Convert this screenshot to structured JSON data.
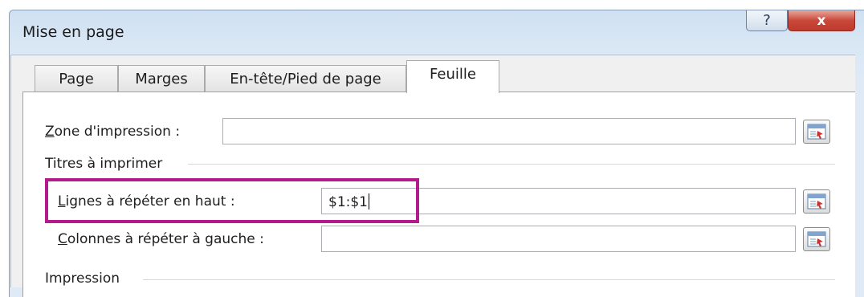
{
  "dialog": {
    "title": "Mise en page",
    "help_label": "?",
    "close_label": "x"
  },
  "tabs": [
    {
      "label": "Page",
      "active": false
    },
    {
      "label": "Marges",
      "active": false
    },
    {
      "label": "En-tête/Pied de page",
      "active": false
    },
    {
      "label": "Feuille",
      "active": true
    }
  ],
  "sheet": {
    "print_area": {
      "label_key": "Z",
      "label_rest": "one d'impression :",
      "value": ""
    },
    "print_titles_heading": "Titres à imprimer",
    "rows_repeat": {
      "label_key": "L",
      "label_rest": "ignes à répéter en haut :",
      "value": "$1:$1"
    },
    "cols_repeat": {
      "label_key": "C",
      "label_rest": "olonnes à répéter à gauche :",
      "value": ""
    },
    "print_heading": "Impression"
  },
  "colors": {
    "highlight": "#b31b8c",
    "close_button": "#c9483a"
  },
  "icons": [
    "help-icon",
    "close-icon",
    "collapse-dialog-icon"
  ]
}
